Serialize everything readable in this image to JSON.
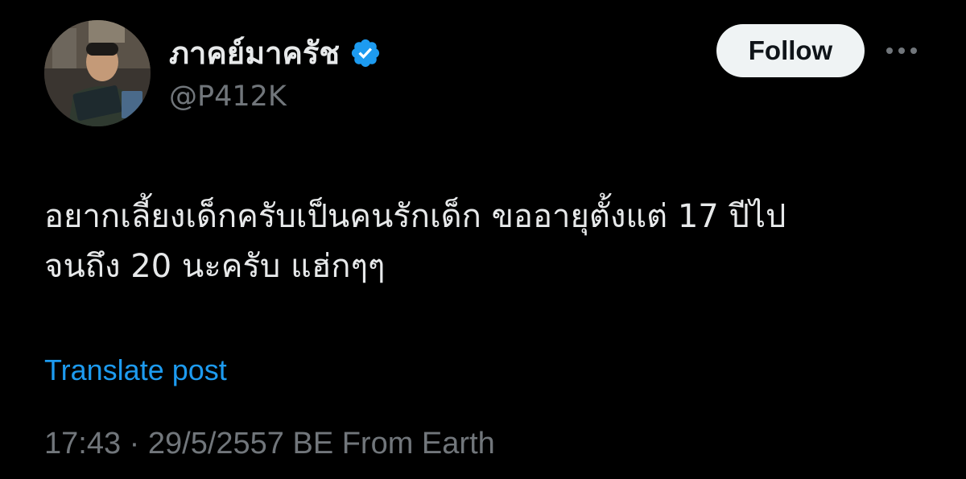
{
  "author": {
    "display_name": "ภาคย์มาครัช",
    "handle": "@P412K",
    "verified_icon": "verified-badge-icon"
  },
  "actions": {
    "follow_label": "Follow",
    "more_icon": "more-horizontal-icon"
  },
  "post": {
    "text_line_1": "อยากเลี้ยงเด็กครับเป็นคนรักเด็ก ขออายุตั้งแต่ 17 ปีไป",
    "text_line_2": "จนถึง 20 นะครับ แฮ่กๆๆ",
    "translate_label": "Translate post",
    "meta": "17:43 · 29/5/2557 BE From Earth"
  },
  "colors": {
    "background": "#000000",
    "text_primary": "#e7e9ea",
    "text_secondary": "#71767b",
    "link": "#1d9bf0",
    "verified": "#1d9bf0",
    "follow_bg": "#eff3f4"
  }
}
